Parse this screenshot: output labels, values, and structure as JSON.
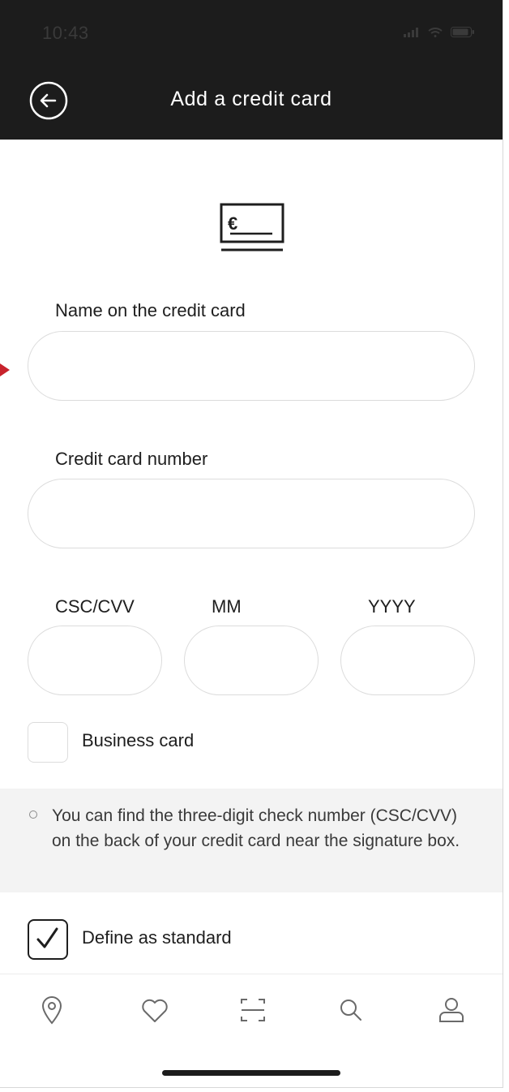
{
  "status_bar": {
    "time": "10:43"
  },
  "header": {
    "title": "Add a credit card",
    "back_icon": "circle-arrow-left-icon",
    "background_color": "#1c1c1c"
  },
  "card_icon": {
    "name": "euro-credit-card-icon",
    "symbol": "€"
  },
  "form": {
    "name_label": "Name on the credit card",
    "name_value": "",
    "number_label": "Credit card number",
    "number_value": "",
    "cvv_label": "CSC/CVV",
    "cvv_value": "",
    "month_label": "MM",
    "month_value": "",
    "year_label": "YYYY",
    "year_value": ""
  },
  "business_card": {
    "label": "Business card",
    "checked": false
  },
  "info": {
    "text": "You can find the three-digit check number (CSC/CVV) on the back of your credit card near the signature box."
  },
  "standard": {
    "label": "Define as standard",
    "checked": true
  },
  "bottom_nav": {
    "items": [
      {
        "icon": "location-pin-icon"
      },
      {
        "icon": "heart-icon"
      },
      {
        "icon": "scan-icon"
      },
      {
        "icon": "search-icon"
      },
      {
        "icon": "user-icon"
      }
    ]
  },
  "colors": {
    "accent_arrow": "#c8232c",
    "input_border": "#dcdcdc",
    "info_background": "#f3f3f3"
  }
}
